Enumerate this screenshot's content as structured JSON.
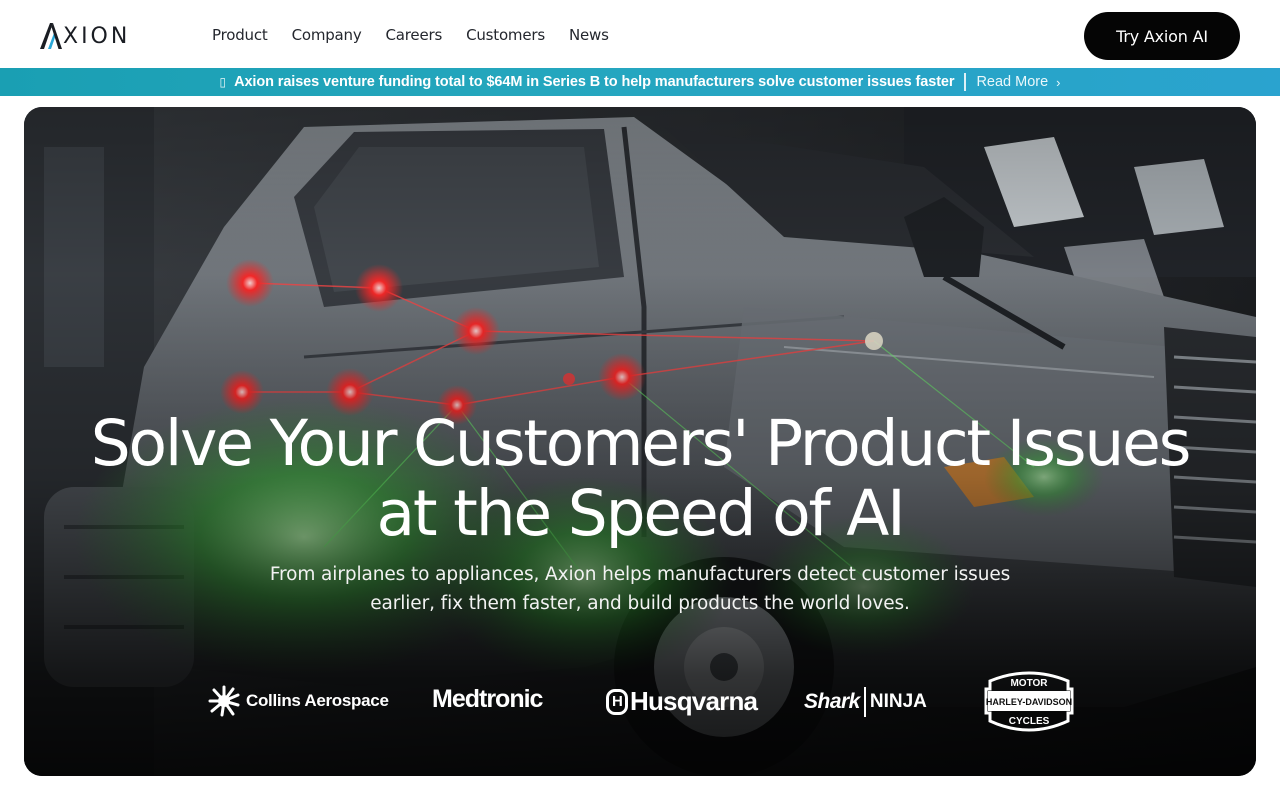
{
  "nav": {
    "logo_text": "XION",
    "logo_icon": "axion-a-icon",
    "items": [
      {
        "label": "Product"
      },
      {
        "label": "Company"
      },
      {
        "label": "Careers"
      },
      {
        "label": "Customers"
      },
      {
        "label": "News"
      }
    ],
    "cta_label": "Try Axion AI"
  },
  "announcement": {
    "icon": "bell-icon",
    "message": "Axion raises venture funding total to $64M in Series B to help manufacturers solve customer issues faster",
    "link_label": "Read More",
    "accent": "#1f9fbf"
  },
  "hero": {
    "title_line1": "Solve Your Customers' Product Issues",
    "title_line2": "at the Speed of AI",
    "subtitle_line1": "From airplanes to appliances, Axion helps manufacturers detect customer issues",
    "subtitle_line2": "earlier, fix them faster, and build products the world loves."
  },
  "customer_logos": [
    {
      "name": "Collins Aerospace"
    },
    {
      "name": "Medtronic"
    },
    {
      "name": "Husqvarna"
    },
    {
      "name": "Shark",
      "name2": "NINJA"
    },
    {
      "name": "MOTOR HARLEY-DAVIDSON CYCLES"
    }
  ],
  "colors": {
    "brand_cyan": "#2aa8d8",
    "cta_bg": "#050505",
    "hero_green_glow": "#4cdc4c",
    "hero_red_points": "#ff2a2a"
  }
}
